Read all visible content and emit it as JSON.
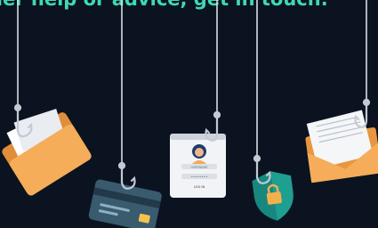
{
  "headline": "ther help or advice, get in touch.",
  "login_card": {
    "username_placeholder": "USERNAME",
    "password_mask": "••••••••",
    "login_label": "LOG IN"
  },
  "colors": {
    "background": "#0b1320",
    "headline": "#3fd9b0",
    "folder": "#f3a955",
    "card": "#3a5a6e",
    "shield": "#22a99b",
    "envelope": "#f3a955",
    "line": "#d7dde4"
  },
  "icons": [
    "fishing-hook-icon",
    "folder-icon",
    "credit-card-icon",
    "login-screen-icon",
    "padlock-shield-icon",
    "envelope-icon"
  ]
}
